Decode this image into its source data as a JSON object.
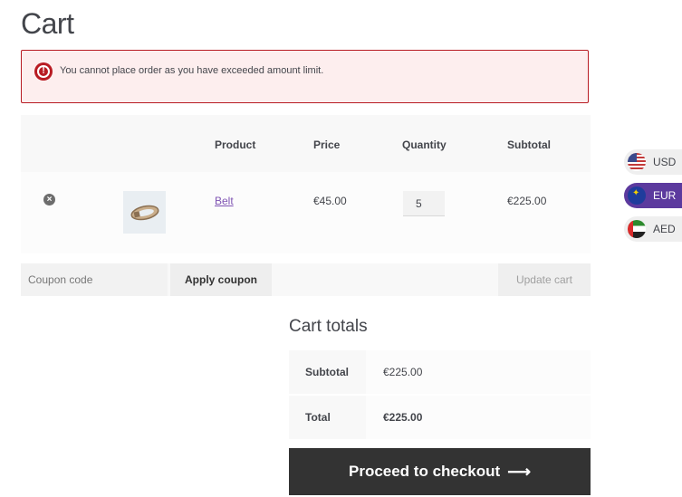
{
  "page": {
    "title": "Cart"
  },
  "notice": {
    "text": "You cannot place order as you have exceeded amount limit.",
    "icon": "error-icon"
  },
  "table": {
    "headers": {
      "product": "Product",
      "price": "Price",
      "quantity": "Quantity",
      "subtotal": "Subtotal"
    },
    "rows": [
      {
        "product": "Belt",
        "price": "€45.00",
        "quantity": "5",
        "subtotal": "€225.00"
      }
    ]
  },
  "actions": {
    "coupon_placeholder": "Coupon code",
    "apply_label": "Apply coupon",
    "update_label": "Update cart"
  },
  "totals": {
    "title": "Cart totals",
    "subtotal_label": "Subtotal",
    "subtotal_value": "€225.00",
    "total_label": "Total",
    "total_value": "€225.00"
  },
  "checkout": {
    "label": "Proceed to checkout",
    "arrow": "⟶"
  },
  "currencies": [
    {
      "code": "USD",
      "flag": "us-flag-icon"
    },
    {
      "code": "EUR",
      "flag": "eu-flag-icon",
      "active": true
    },
    {
      "code": "AED",
      "flag": "ae-flag-icon"
    }
  ],
  "colors": {
    "error": "#b81c23",
    "link": "#7f54b3",
    "checkout_bg": "#333333",
    "active_currency": "#5c3a9e"
  }
}
